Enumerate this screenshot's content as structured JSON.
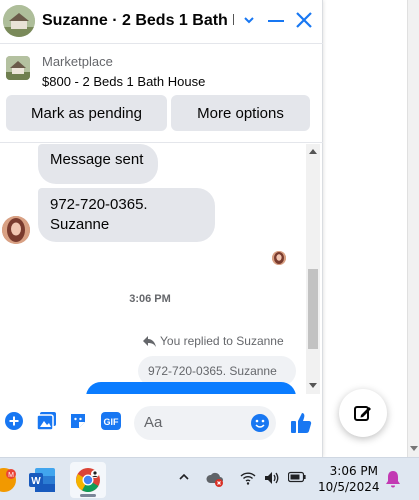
{
  "chat": {
    "title": "Suzanne · 2 Beds 1 Bath H...",
    "listing": {
      "source": "Marketplace",
      "title": "$800 - 2 Beds 1 Bath House"
    },
    "buttons": {
      "mark_pending": "Mark as pending",
      "more_options": "More options"
    },
    "messages": {
      "first": "Message sent",
      "second": "972-720-0365. Suzanne",
      "timestamp": "3:06 PM",
      "replied_note": "You replied to Suzanne",
      "quoted": "972-720-0365. Suzanne"
    },
    "composer": {
      "placeholder": "Aa"
    }
  },
  "taskbar": {
    "time": "3:06 PM",
    "date": "10/5/2024"
  },
  "colors": {
    "accent": "#1877f2",
    "outgoing_bubble": "#0a7cff",
    "incoming_bubble": "#e4e6eb"
  }
}
